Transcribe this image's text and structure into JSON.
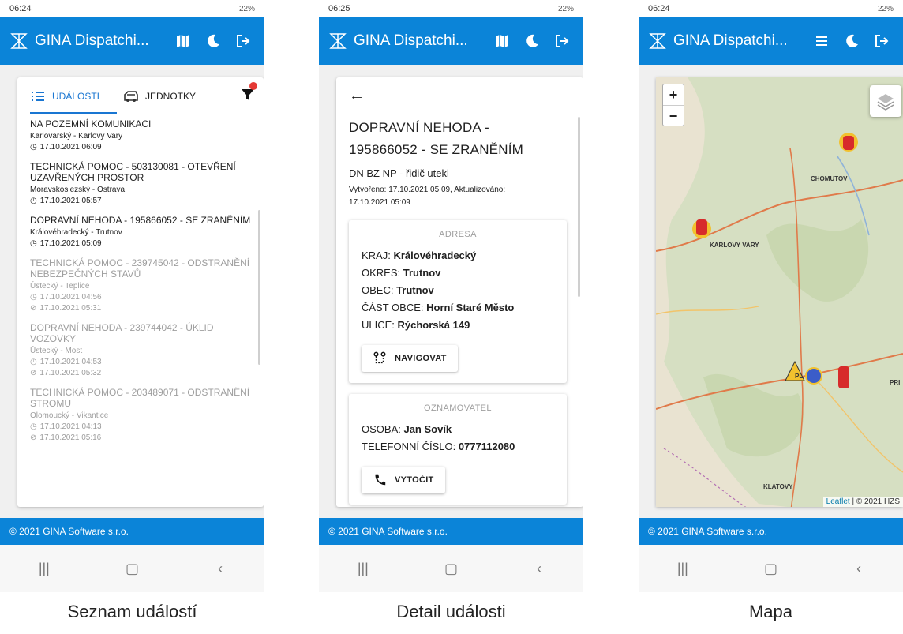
{
  "app": {
    "title": "GINA Dispatchi...",
    "footer": "© 2021 GINA Software s.r.o.",
    "accent": "#0b84d8"
  },
  "phones": [
    {
      "status_time": "06:24",
      "status_right": "22%",
      "caption": "Seznam událostí",
      "tabs": [
        {
          "label": "UDÁLOSTI",
          "icon": "list-icon",
          "active": true
        },
        {
          "label": "JEDNOTKY",
          "icon": "fire-truck-icon",
          "active": false
        }
      ],
      "events": [
        {
          "title": "NA POZEMNÍ KOMUNIKACI",
          "region": "Karlovarský - Karlovy Vary",
          "times": [
            "17.10.2021 06:09"
          ],
          "faded": false
        },
        {
          "title": "TECHNICKÁ POMOC - 503130081 - OTEVŘENÍ UZAVŘENÝCH PROSTOR",
          "region": "Moravskoslezský - Ostrava",
          "times": [
            "17.10.2021 05:57"
          ],
          "faded": false
        },
        {
          "title": "DOPRAVNÍ NEHODA - 195866052 - SE ZRANĚNÍM",
          "region": "Královéhradecký - Trutnov",
          "times": [
            "17.10.2021 05:09"
          ],
          "faded": false
        },
        {
          "title": "TECHNICKÁ POMOC - 239745042 - ODSTRANĚNÍ NEBEZPEČNÝCH STAVŮ",
          "region": "Ústecký - Teplice",
          "times": [
            "17.10.2021 04:56",
            "17.10.2021 05:31"
          ],
          "faded": true
        },
        {
          "title": "DOPRAVNÍ NEHODA - 239744042 - ÚKLID VOZOVKY",
          "region": "Ústecký - Most",
          "times": [
            "17.10.2021 04:53",
            "17.10.2021 05:32"
          ],
          "faded": true
        },
        {
          "title": "TECHNICKÁ POMOC - 203489071 - ODSTRANĚNÍ STROMU",
          "region": "Olomoucký - Vikantice",
          "times": [
            "17.10.2021 04:13",
            "17.10.2021 05:16"
          ],
          "faded": true
        }
      ]
    },
    {
      "status_time": "06:25",
      "status_right": "22%",
      "caption": "Detail události",
      "detail": {
        "title_line1": "DOPRAVNÍ NEHODA -",
        "title_line2": "195866052 - SE ZRANĚNÍM",
        "subtitle": "DN BZ NP - řidič utekl",
        "meta_line1": "Vytvořeno: 17.10.2021 05:09, Aktualizováno:",
        "meta_line2": "17.10.2021 05:09",
        "address": {
          "heading": "ADRESA",
          "rows": [
            {
              "label": "KRAJ: ",
              "value": "Královéhradecký"
            },
            {
              "label": "OKRES: ",
              "value": "Trutnov"
            },
            {
              "label": "OBEC: ",
              "value": "Trutnov"
            },
            {
              "label": "ČÁST OBCE: ",
              "value": "Horní Staré Město"
            },
            {
              "label": "ULICE: ",
              "value": "Rýchorská 149"
            }
          ],
          "button": "NAVIGOVAT"
        },
        "reporter": {
          "heading": "OZNAMOVATEL",
          "rows": [
            {
              "label": "OSOBA: ",
              "value": "Jan Sovík"
            },
            {
              "label": "TELEFONNÍ ČÍSLO: ",
              "value": "0777112080"
            }
          ],
          "button": "VYTOČIT"
        }
      }
    },
    {
      "status_time": "06:24",
      "status_right": "22%",
      "caption": "Mapa",
      "map": {
        "labels": [
          "KARLOVY VARY",
          "CHOMUTOV",
          "KLATOVY",
          "PL",
          "PRI"
        ],
        "zoom_in": "+",
        "zoom_out": "−",
        "attribution_link": "Leaflet",
        "attribution_text": " | © 2021 HZS"
      }
    }
  ]
}
